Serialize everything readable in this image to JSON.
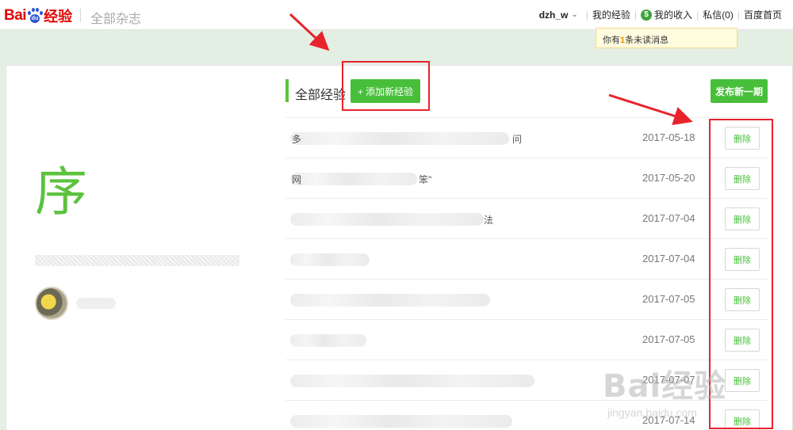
{
  "header": {
    "logo_text_bai": "Bai",
    "logo_text_du": "du",
    "logo_text_jingyan": "经验",
    "site_title": "全部杂志"
  },
  "nav": {
    "username": "dzh_w",
    "my_experience": "我的经验",
    "income_icon": "$",
    "my_income": "我的收入",
    "messages": "私信(0)",
    "home": "百度首页"
  },
  "tooltip": {
    "prefix": "你有",
    "count": "1",
    "suffix": "条未读消息"
  },
  "sidebar": {
    "big_char": "序"
  },
  "section": {
    "title": "全部经验",
    "add_button": "+ 添加新经验",
    "publish_button": "发布新一期"
  },
  "rows": [
    {
      "prefix": "多",
      "suffix": "问",
      "date": "2017-05-18",
      "delete": "删除"
    },
    {
      "prefix": "网",
      "suffix": "笨\"",
      "date": "2017-05-20",
      "delete": "删除"
    },
    {
      "prefix": "",
      "suffix": "法",
      "date": "2017-07-04",
      "delete": "删除"
    },
    {
      "prefix": "",
      "suffix": "",
      "date": "2017-07-04",
      "delete": "删除"
    },
    {
      "prefix": "",
      "suffix": "",
      "date": "2017-07-05",
      "delete": "删除"
    },
    {
      "prefix": "",
      "suffix": "",
      "date": "2017-07-05",
      "delete": "删除"
    },
    {
      "prefix": "",
      "suffix": "",
      "date": "2017-07-07",
      "delete": "删除"
    },
    {
      "prefix": "",
      "suffix": "",
      "date": "2017-07-14",
      "delete": "删除"
    }
  ],
  "watermark": {
    "logo": "Bai经验",
    "url": "jingyan.baidu.com"
  },
  "colors": {
    "accent_green": "#47bf3a",
    "brand_red": "#e10602",
    "annotation_red": "#e8232c"
  }
}
